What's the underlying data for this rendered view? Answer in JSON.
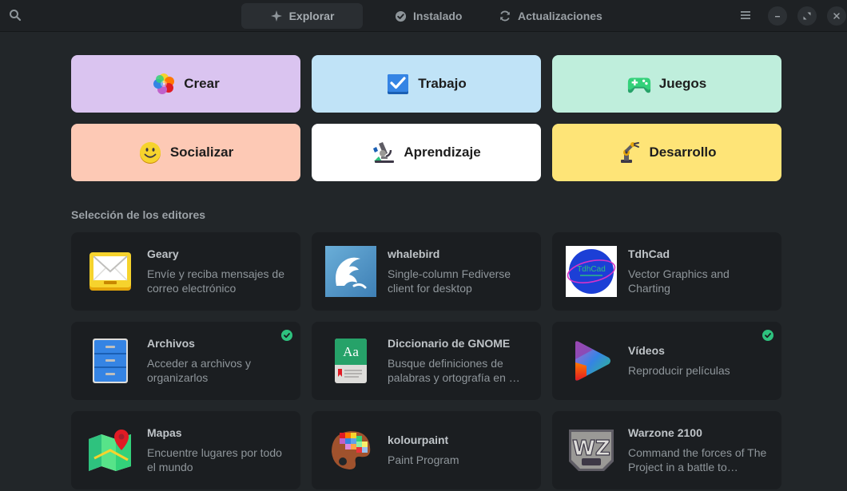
{
  "header": {
    "tabs": [
      {
        "label": "Explorar",
        "active": true
      },
      {
        "label": "Instalado",
        "active": false
      },
      {
        "label": "Actualizaciones",
        "active": false
      }
    ]
  },
  "categories": [
    {
      "label": "Crear",
      "color": "#dac4f0"
    },
    {
      "label": "Trabajo",
      "color": "#c0e3f7"
    },
    {
      "label": "Juegos",
      "color": "#bfeedc"
    },
    {
      "label": "Socializar",
      "color": "#fdc9b5"
    },
    {
      "label": "Aprendizaje",
      "color": "#ffffff"
    },
    {
      "label": "Desarrollo",
      "color": "#fee477"
    }
  ],
  "editors": {
    "title": "Selección de los editores",
    "apps": [
      {
        "name": "Geary",
        "description": "Envíe y reciba mensajes de correo electrónico",
        "installed": false
      },
      {
        "name": "whalebird",
        "description": "Single-column Fediverse client for desktop",
        "installed": false
      },
      {
        "name": "TdhCad",
        "description": "Vector Graphics and Charting",
        "installed": false,
        "icon_text": "TdhCad"
      },
      {
        "name": "Archivos",
        "description": "Acceder a archivos y organizarlos",
        "installed": true
      },
      {
        "name": "Diccionario de GNOME",
        "description": "Busque definiciones de palabras y ortografía en …",
        "installed": false,
        "icon_text": "Aa"
      },
      {
        "name": "Vídeos",
        "description": "Reproducir películas",
        "installed": true
      },
      {
        "name": "Mapas",
        "description": "Encuentre lugares por todo el mundo",
        "installed": false
      },
      {
        "name": "kolourpaint",
        "description": "Paint Program",
        "installed": false
      },
      {
        "name": "Warzone 2100",
        "description": "Command the forces of The Project in a battle to…",
        "installed": false,
        "icon_text": "WZ"
      }
    ]
  },
  "colors": {
    "background": "#222629",
    "tile": "#1b1e21",
    "installed_badge": "#2ec27e"
  }
}
